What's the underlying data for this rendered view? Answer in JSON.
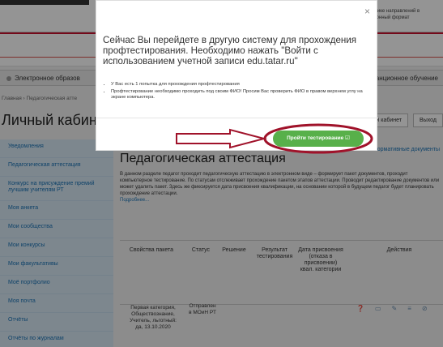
{
  "header": {
    "right_text": "экономике направлений в электронный формат"
  },
  "nav": {
    "left": "Электронное образов",
    "right": "станционное обучение"
  },
  "breadcrumb": "Главная › Педагогическая атте",
  "page_title": "Личный кабинет",
  "top_buttons": {
    "cabinet": "ный кабинет",
    "logout": "Выход"
  },
  "sidebar": {
    "items": [
      {
        "label": "Уведомления"
      },
      {
        "label": "Педагогическая аттестация"
      },
      {
        "label": "Конкурс на присуждение премий лучшим учителям РТ"
      },
      {
        "label": "Моя анкета"
      },
      {
        "label": "Мои сообщества"
      },
      {
        "label": "Мои конкурсы"
      },
      {
        "label": "Мои факультативы"
      },
      {
        "label": "Моё портфолио"
      },
      {
        "label": "Моя почта"
      },
      {
        "label": "Отчёты"
      },
      {
        "label": "Отчёты по журналам"
      }
    ]
  },
  "main": {
    "norm_link": "Нормативные документы",
    "title": "Педагогическая аттестация",
    "description": "В данном разделе педагог проходит педагогическую аттестацию в электронном виде – формирует пакет документов, проходит компьютерное тестирование. По статусам отслеживает прохождение пакетом этапов аттестации. Проводит редактирование документов или может удалить пакет. Здесь же фиксируется дата присвоения квалификации, на основании которой в будущем педагог будет планировать прохождение аттестации.",
    "more": "Подробнее..."
  },
  "table": {
    "headers": [
      "Свойства пакета",
      "Статус",
      "Решение",
      "Результат тестирования",
      "Дата присвоения (отказа в присвоении) квал. категории",
      "Действия"
    ],
    "row": {
      "props": "Первая категория, Обществознание, Учитель, льготный: да, 13.10.2020",
      "status": "Отправлен в МОиН РТ"
    }
  },
  "modal": {
    "close": "×",
    "text": "Сейчас Вы перейдете в другую систему для прохождения профтестирования. Необходимо нажать \"Войти с использованием учетной записи edu.tatar.ru\"",
    "bullets": [
      "У Вас есть 1 попытка для прохождения профтестирования",
      "Профтестирование необходимо проходить под своим ФИО! Просим Вас проверить ФИО в правом верхнем углу на экране компьютера."
    ]
  },
  "start_button": {
    "label": "Пройти тестирование ☑"
  },
  "colors": {
    "accent_green": "#58b04a",
    "annotation_red": "#a0122a",
    "link_blue": "#1a73b5"
  }
}
